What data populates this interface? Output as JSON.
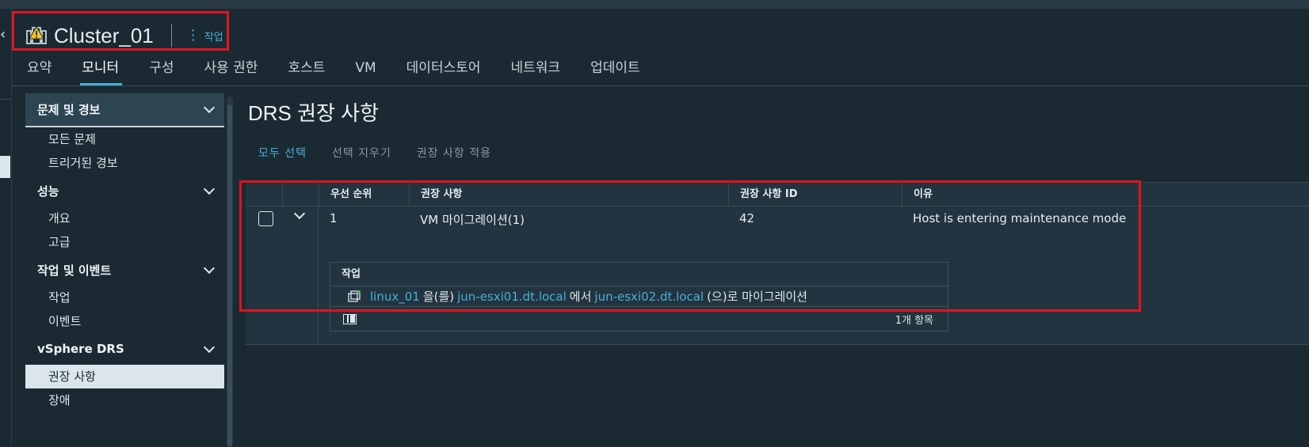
{
  "object_header": {
    "title": "Cluster_01",
    "actions_label": "작업"
  },
  "tabs": [
    {
      "label": "요약"
    },
    {
      "label": "모니터"
    },
    {
      "label": "구성"
    },
    {
      "label": "사용 권한"
    },
    {
      "label": "호스트"
    },
    {
      "label": "VM"
    },
    {
      "label": "데이터스토어"
    },
    {
      "label": "네트워크"
    },
    {
      "label": "업데이트"
    }
  ],
  "active_tab": "모니터",
  "sidenav": {
    "groups": [
      {
        "label": "문제 및 경보",
        "items": [
          "모든 문제",
          "트리거된 경보"
        ]
      },
      {
        "label": "성능",
        "items": [
          "개요",
          "고급"
        ]
      },
      {
        "label": "작업 및 이벤트",
        "items": [
          "작업",
          "이벤트"
        ]
      },
      {
        "label": "vSphere DRS",
        "items": [
          "권장 사항",
          "장애"
        ]
      }
    ],
    "selected_item": "권장 사항"
  },
  "main": {
    "title": "DRS 권장 사항",
    "toolbar": {
      "select_all": "모두 선택",
      "clear_selection": "선택 지우기",
      "apply": "권장 사항 적용"
    },
    "grid": {
      "columns": [
        "우선 순위",
        "권장 사항",
        "권장 사항 ID",
        "이유"
      ],
      "rows": [
        {
          "priority": "1",
          "recommendation": "VM 마이그레이션(1)",
          "id": "42",
          "reason": "Host is entering maintenance mode"
        }
      ],
      "detail": {
        "header": "작업",
        "vm": "linux_01",
        "text_1": "을(를)",
        "source_host": "jun-esxi01.dt.local",
        "text_2": "에서",
        "target_host": "jun-esxi02.dt.local",
        "text_3": "(으)로 마이그레이션",
        "footer_count": "1개 항목"
      }
    }
  },
  "colors": {
    "background": "#1b2a32",
    "accent": "#49afd9",
    "highlight_box": "#e0131f",
    "warning": "#f5c518"
  },
  "icons": {
    "cluster": "cluster-warning-icon",
    "vm": "vm-icon",
    "column_toggle": "column-toggle-icon"
  }
}
